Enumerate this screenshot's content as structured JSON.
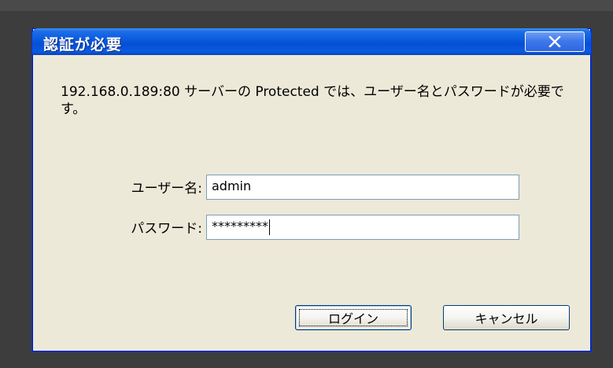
{
  "dialog": {
    "title": "認証が必要",
    "message": "192.168.0.189:80 サーバーの Protected では、ユーザー名とパスワードが必要です。",
    "username_label": "ユーザー名:",
    "username_value": "admin",
    "password_label": "パスワード:",
    "password_value": "*********",
    "login_button": "ログイン",
    "cancel_button": "キャンセル",
    "close_icon": "close-x-icon"
  },
  "colors": {
    "titlebar": "#0a58dc",
    "dialog_bg": "#ece9d8",
    "backdrop": "#3d3d3d"
  }
}
